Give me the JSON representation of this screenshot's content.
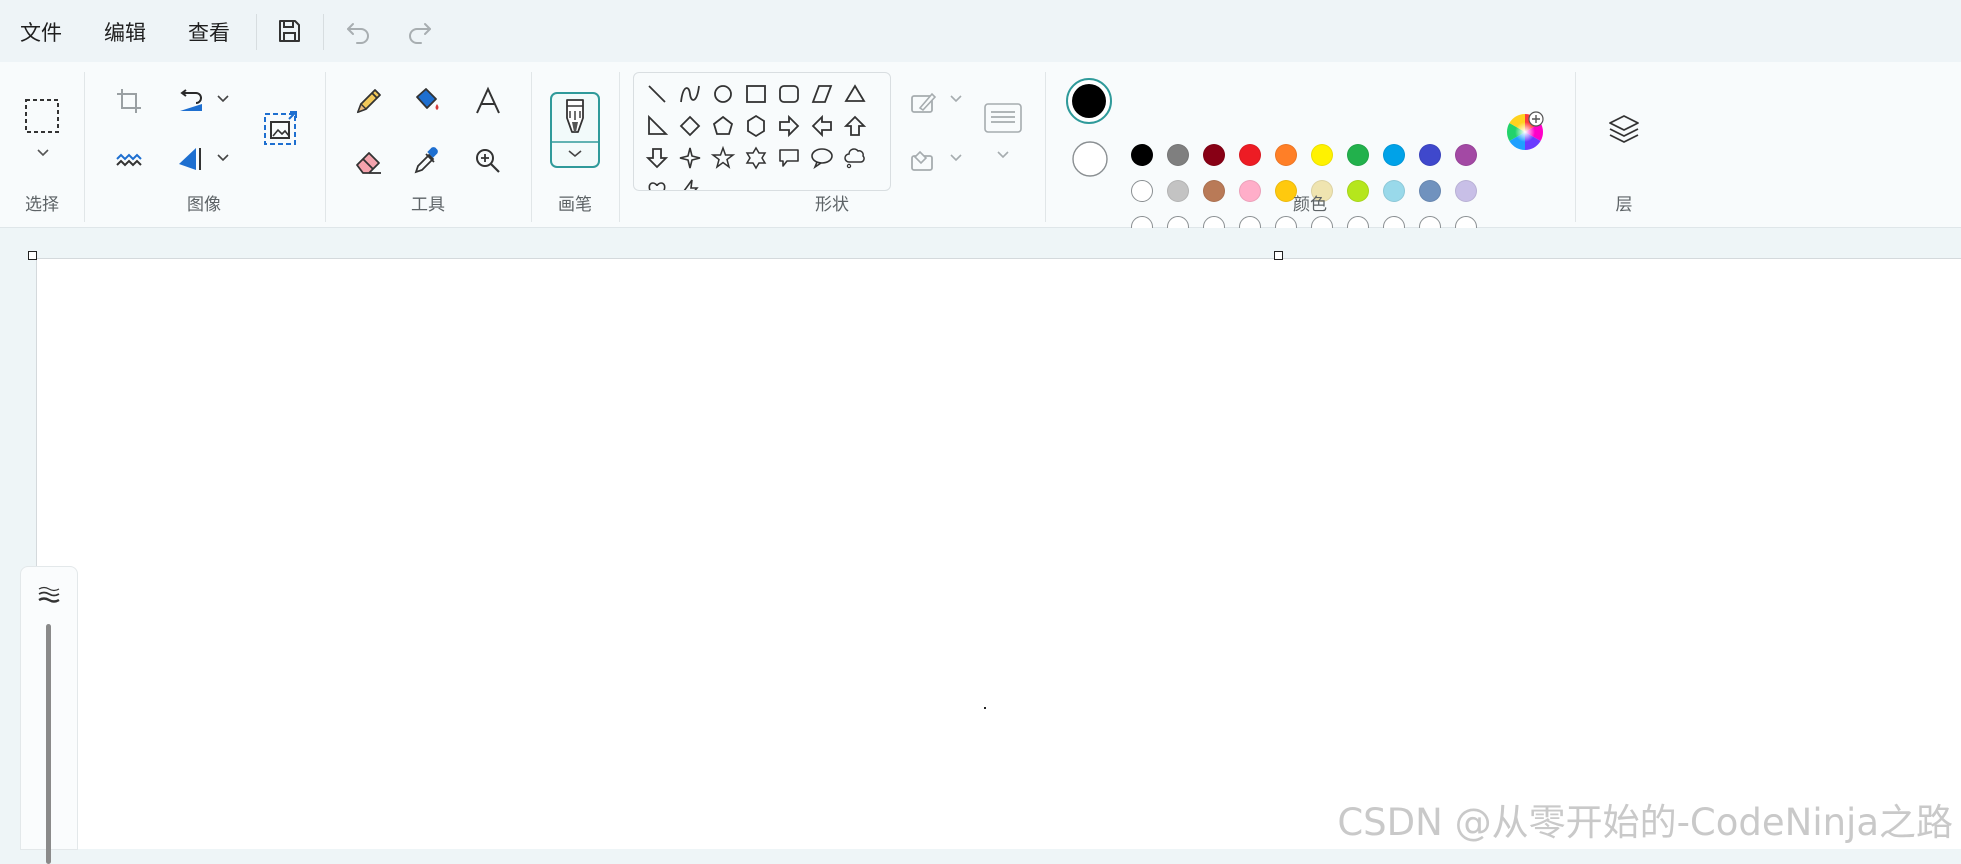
{
  "menu": {
    "file": "文件",
    "edit": "编辑",
    "view": "查看"
  },
  "ribbon": {
    "groups": {
      "select": "选择",
      "image": "图像",
      "tools": "工具",
      "brushes": "画笔",
      "shapes": "形状",
      "colors": "颜色",
      "layers": "层"
    }
  },
  "colors": {
    "primary": "#000000",
    "secondary": "#ffffff",
    "accent": "#2f9a9a",
    "row1": [
      "#000000",
      "#7f7f7f",
      "#880015",
      "#ed1c24",
      "#ff7f27",
      "#fff200",
      "#22b14c",
      "#00a2e8",
      "#3f48cc",
      "#a349a4"
    ],
    "row2": [
      "#ffffff",
      "#c3c3c3",
      "#b97a57",
      "#ffaec9",
      "#ffc90e",
      "#efe4b0",
      "#b5e61d",
      "#99d9ea",
      "#7092be",
      "#c8bfe7"
    ]
  },
  "watermark": "CSDN @从零开始的-CodeNinja之路"
}
